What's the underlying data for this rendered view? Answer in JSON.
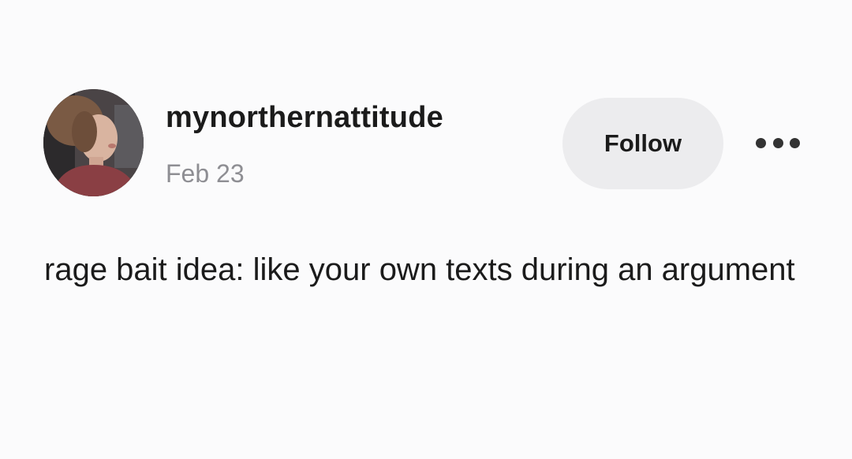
{
  "post": {
    "author": {
      "username": "mynorthernattitude",
      "date": "Feb 23",
      "avatar_icon": "profile-photo"
    },
    "follow_label": "Follow",
    "more_icon": "more-horizontal-icon",
    "text": "rage bait idea: like your own texts during an argument"
  },
  "colors": {
    "background": "#fbfbfc",
    "follow_button_bg": "#ececee",
    "date_text": "#8e8e93",
    "primary_text": "#1b1b1b"
  }
}
